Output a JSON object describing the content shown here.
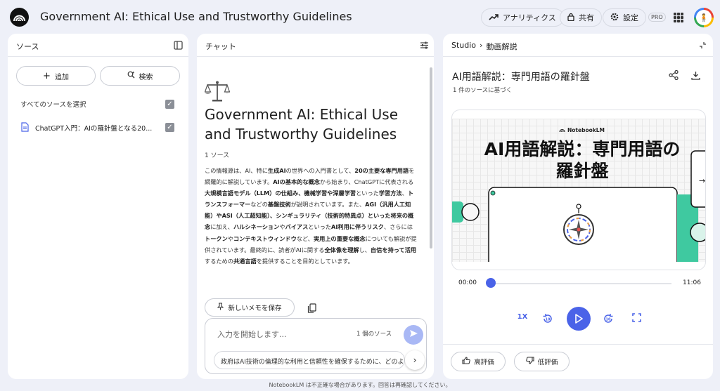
{
  "app": {
    "title": "Government AI: Ethical Use and Trustworthy Guidelines"
  },
  "header": {
    "analytics_label": "アナリティクス",
    "share_label": "共有",
    "settings_label": "設定",
    "pro_badge": "PRO"
  },
  "sources": {
    "title": "ソース",
    "add_label": "追加",
    "search_label": "検索",
    "select_all_label": "すべてのソースを選択",
    "items": [
      {
        "label": "ChatGPT入門：AIの羅針盤となる20..."
      }
    ]
  },
  "chat": {
    "title": "チャット",
    "doc_title": "Government AI: Ethical Use and Trustworthy Guidelines",
    "source_count": "1 ソース",
    "summary": [
      {
        "t": "この情報源は、AI、特に"
      },
      {
        "t": "生成AI",
        "b": true
      },
      {
        "t": "の世界への入門書として、"
      },
      {
        "t": "20の主要な専門用語",
        "b": true
      },
      {
        "t": "を網羅的に解説しています。"
      },
      {
        "t": "AIの基本的な概念",
        "b": true
      },
      {
        "t": "から始まり、ChatGPTに代表される"
      },
      {
        "t": "大規模言語モデル（LLM）の仕組み、機械学習や深層学習",
        "b": true
      },
      {
        "t": "といった"
      },
      {
        "t": "学習方法",
        "b": true
      },
      {
        "t": "、"
      },
      {
        "t": "トランスフォーマー",
        "b": true
      },
      {
        "t": "などの"
      },
      {
        "t": "基盤技術",
        "b": true
      },
      {
        "t": "が説明されています。また、"
      },
      {
        "t": "AGI（汎用人工知能）やASI（人工超知能）、シンギュラリティ（技術的特異点）といった将来の概念",
        "b": true
      },
      {
        "t": "に加え、"
      },
      {
        "t": "ハルシネーション",
        "b": true
      },
      {
        "t": "や"
      },
      {
        "t": "バイアス",
        "b": true
      },
      {
        "t": "といった"
      },
      {
        "t": "AI利用に伴うリスク",
        "b": true
      },
      {
        "t": "、さらには"
      },
      {
        "t": "トークン",
        "b": true
      },
      {
        "t": "や"
      },
      {
        "t": "コンテキストウィンドウ",
        "b": true
      },
      {
        "t": "など、"
      },
      {
        "t": "実用上の重要な概念",
        "b": true
      },
      {
        "t": "についても解説が提供されています。最終的に、読者がAIに関する"
      },
      {
        "t": "全体像を理解",
        "b": true
      },
      {
        "t": "し、"
      },
      {
        "t": "自信を持って活用",
        "b": true
      },
      {
        "t": "するための"
      },
      {
        "t": "共通言語",
        "b": true
      },
      {
        "t": "を提供することを目的としています。"
      }
    ],
    "save_memo_label": "新しいメモを保存",
    "input_placeholder": "入力を開始します...",
    "input_source_count": "1 個のソース",
    "suggestion": "政府はAI技術の倫理的な利用と信頼性を確保するために、どのよ"
  },
  "studio": {
    "breadcrumb_root": "Studio",
    "breadcrumb_current": "動画解説",
    "title": "AI用語解説：専門用語の羅針盤",
    "subtitle": "1 件のソースに基づく",
    "video_brand": "NotebookLM",
    "video_title": "AI用語解説：専門用語の羅針盤",
    "time_current": "00:00",
    "time_total": "11:06",
    "progress": 0,
    "speed_label": "1X",
    "rewind_label": "10",
    "forward_label": "10",
    "like_label": "高評価",
    "dislike_label": "低評価"
  },
  "footer": {
    "disclaimer": "NotebookLM は不正確な場合があります。回答は再確認してください。"
  },
  "colors": {
    "accent": "#4a63e8",
    "background": "#eef0f8",
    "send_disabled": "#a9b8f5"
  }
}
